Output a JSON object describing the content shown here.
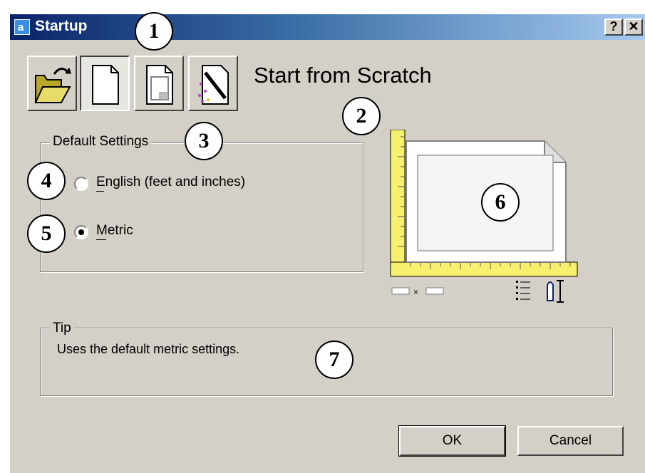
{
  "window": {
    "title": "Startup",
    "help_button": "?",
    "close_button": "✕"
  },
  "toolbar": {
    "buttons": [
      {
        "name": "open-drawing",
        "pressed": false
      },
      {
        "name": "start-from-scratch",
        "pressed": true
      },
      {
        "name": "use-template",
        "pressed": false
      },
      {
        "name": "use-wizard",
        "pressed": false
      }
    ]
  },
  "heading": "Start from Scratch",
  "default_settings": {
    "legend": "Default Settings",
    "options": [
      {
        "label": "English (feet and inches)",
        "selected": false
      },
      {
        "label": "Metric",
        "selected": true
      }
    ]
  },
  "tip": {
    "legend": "Tip",
    "text": "Uses the default metric settings."
  },
  "buttons": {
    "ok": "OK",
    "cancel": "Cancel"
  },
  "callouts": [
    "1",
    "2",
    "3",
    "4",
    "5",
    "6",
    "7"
  ],
  "colors": {
    "dialog_bg": "#d4d0c8",
    "titlebar_start": "#0a246a",
    "titlebar_end": "#a6caf0",
    "ruler_yellow": "#f7ef6e"
  }
}
